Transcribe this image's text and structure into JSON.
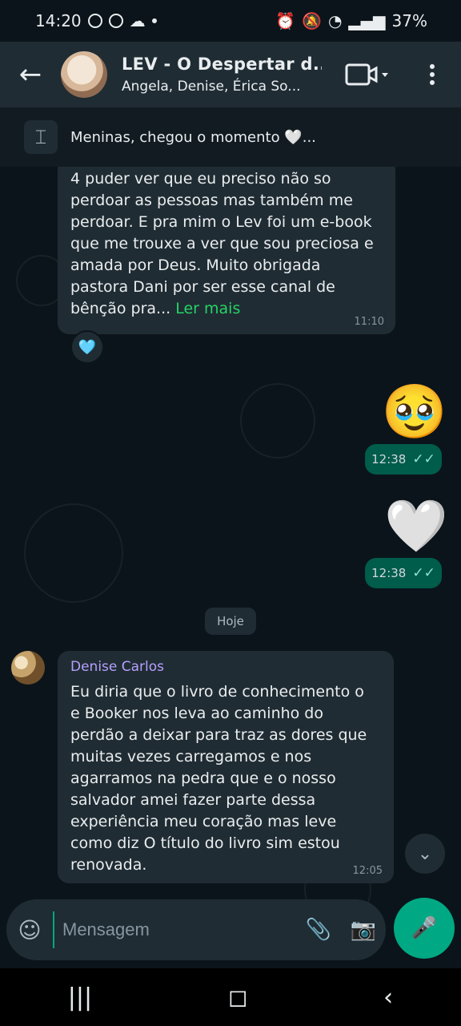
{
  "status": {
    "time": "14:20",
    "battery": "37%"
  },
  "header": {
    "title": "LEV - O Despertar d...",
    "subtitle": "Angela, Denise, Érica So..."
  },
  "pinned": {
    "text": "Meninas, chegou o momento 🤍..."
  },
  "messages": {
    "incoming_1": {
      "text": "4 puder ver que eu preciso não so perdoar as pessoas mas também me perdoar. E pra mim o Lev foi um e-book que me trouxe a ver que sou preciosa e amada por Deus. Muito obrigada pastora Dani por ser esse canal de bênção pra...",
      "read_more": "Ler mais",
      "time": "11:10",
      "reaction": "🩵"
    },
    "outgoing_1": {
      "emoji": "🥹",
      "time": "12:38"
    },
    "outgoing_2": {
      "emoji": "🤍",
      "time": "12:38"
    },
    "date_label": "Hoje",
    "incoming_2": {
      "sender": "Denise Carlos",
      "text": "Eu diria que o livro de conhecimento o e Booker nos leva ao caminho do perdão a deixar para traz as dores que muitas vezes carregamos e nos agarramos na pedra que e o nosso salvador amei fazer parte dessa experiência meu coração mas leve como diz O título do livro sim estou renovada.",
      "time": "12:05"
    }
  },
  "composer": {
    "placeholder": "Mensagem"
  },
  "colors": {
    "background": "#0b141a",
    "incoming_bubble": "#202c33",
    "outgoing_bubble": "#005c4b",
    "accent": "#00a884",
    "sender_name": "#b6a0ff"
  },
  "icons": {
    "back": "arrow-left-icon",
    "video": "video-camera-icon",
    "more": "more-vertical-icon",
    "pin": "pin-icon",
    "sticker": "sticker-icon",
    "attach": "paperclip-icon",
    "camera": "camera-icon",
    "mic": "microphone-icon"
  }
}
